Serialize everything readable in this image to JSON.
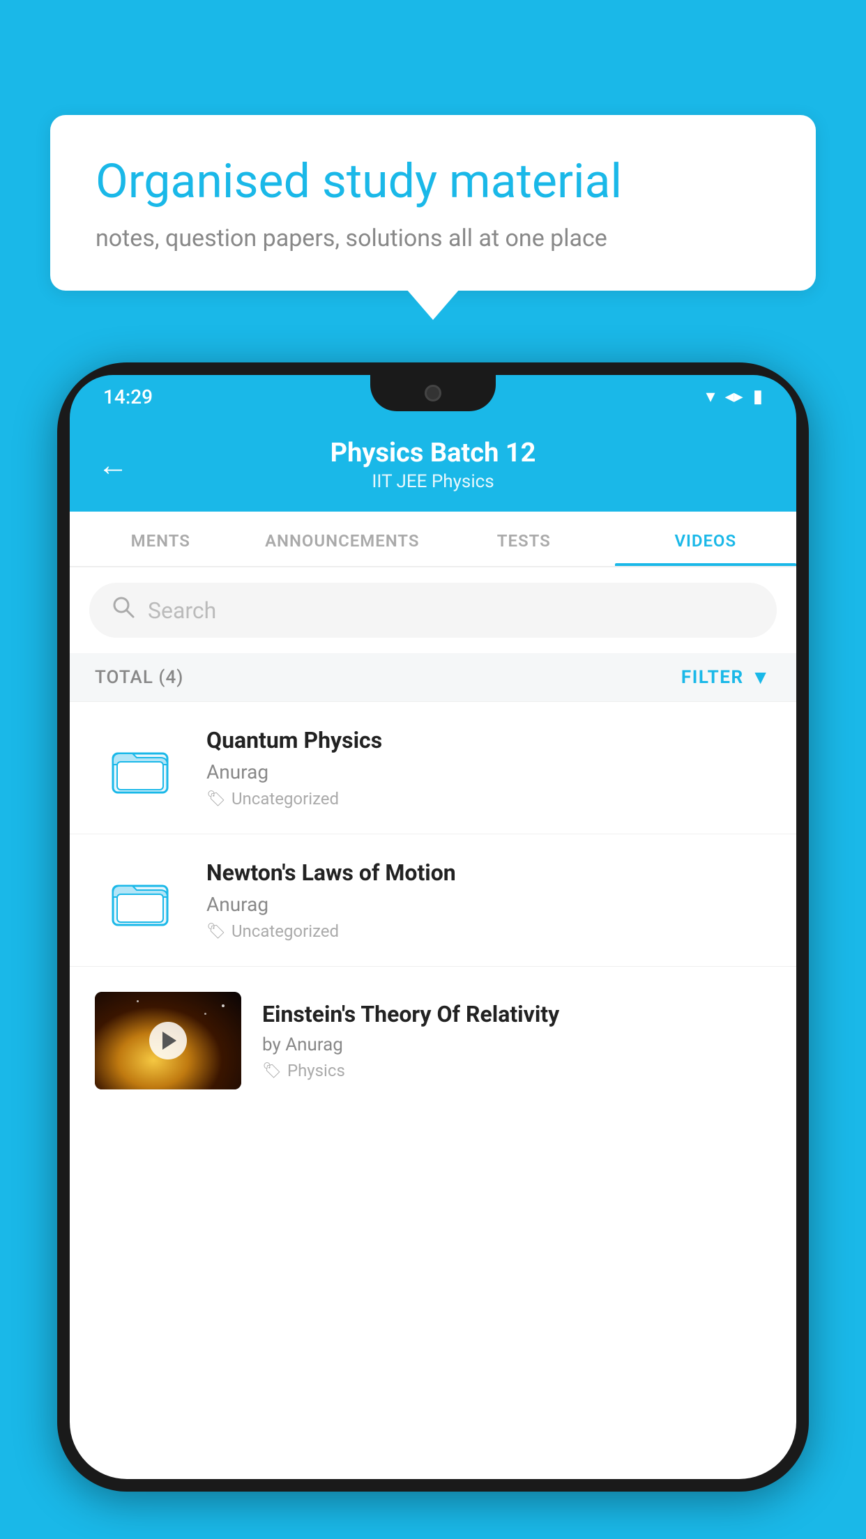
{
  "background_color": "#1ab8e8",
  "speech_bubble": {
    "title": "Organised study material",
    "subtitle": "notes, question papers, solutions all at one place"
  },
  "status_bar": {
    "time": "14:29",
    "wifi": "▾",
    "signal": "▴",
    "battery": "▮"
  },
  "app_header": {
    "back_label": "←",
    "title": "Physics Batch 12",
    "subtitle": "IIT JEE   Physics"
  },
  "tabs": [
    {
      "label": "MENTS",
      "active": false
    },
    {
      "label": "ANNOUNCEMENTS",
      "active": false
    },
    {
      "label": "TESTS",
      "active": false
    },
    {
      "label": "VIDEOS",
      "active": true
    }
  ],
  "search": {
    "placeholder": "Search"
  },
  "filter_row": {
    "total_label": "TOTAL (4)",
    "filter_label": "FILTER"
  },
  "videos": [
    {
      "id": 1,
      "title": "Quantum Physics",
      "author": "Anurag",
      "tag": "Uncategorized",
      "has_thumb": false
    },
    {
      "id": 2,
      "title": "Newton's Laws of Motion",
      "author": "Anurag",
      "tag": "Uncategorized",
      "has_thumb": false
    },
    {
      "id": 3,
      "title": "Einstein's Theory Of Relativity",
      "author": "by Anurag",
      "tag": "Physics",
      "has_thumb": true
    }
  ]
}
